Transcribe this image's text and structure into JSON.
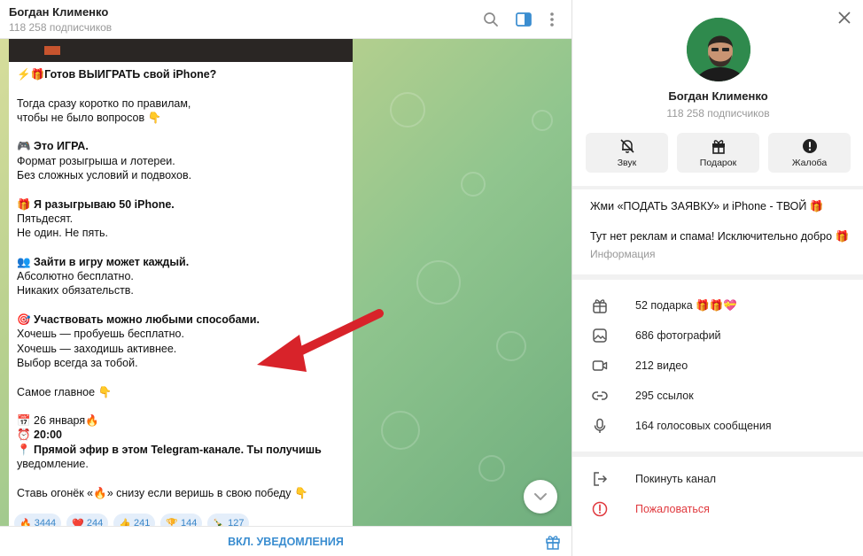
{
  "chat": {
    "title": "Богдан Клименко",
    "subscribers": "118 258 подписчиков",
    "message": {
      "lines": [
        {
          "text": "⚡🎁Готов ВЫИГРАТЬ свой iPhone?",
          "bold": true
        },
        {
          "text": ""
        },
        {
          "text": "Тогда сразу коротко по правилам,"
        },
        {
          "text": "чтобы не было вопросов 👇"
        },
        {
          "text": ""
        },
        {
          "text": "🎮 Это ИГРА.",
          "bold": true
        },
        {
          "text": "Формат розыгрыша и лотереи."
        },
        {
          "text": "Без сложных условий и подвохов."
        },
        {
          "text": ""
        },
        {
          "text": "🎁 Я разыгрываю 50 iPhone.",
          "bold": true
        },
        {
          "text": "Пятьдесят."
        },
        {
          "text": "Не один. Не пять."
        },
        {
          "text": ""
        },
        {
          "text": "👥 Зайти в игру может каждый.",
          "bold": true
        },
        {
          "text": "Абсолютно бесплатно."
        },
        {
          "text": "Никаких обязательств."
        },
        {
          "text": ""
        },
        {
          "text": "🎯 Участвовать можно любыми способами.",
          "bold": true
        },
        {
          "text": "Хочешь — пробуешь бесплатно."
        },
        {
          "text": "Хочешь — заходишь активнее."
        },
        {
          "text": "Выбор всегда за тобой."
        },
        {
          "text": ""
        },
        {
          "text": "Самое главное 👇"
        },
        {
          "text": ""
        },
        {
          "text": "📅 26 января🔥"
        },
        {
          "text": "⏰ 20:00",
          "bold": true
        },
        {
          "text": "📍 Прямой эфир в этом Telegram-канале. Ты получишь",
          "bold": true
        },
        {
          "text": "уведомление."
        },
        {
          "text": ""
        },
        {
          "text": "Ставь огонёк «🔥» снизу если веришь в свою победу 👇"
        }
      ]
    },
    "reactions": [
      {
        "emoji": "🔥",
        "count": "3444"
      },
      {
        "emoji": "❤️",
        "count": "244"
      },
      {
        "emoji": "👍",
        "count": "241"
      },
      {
        "emoji": "🏆",
        "count": "144"
      },
      {
        "emoji": "🍾",
        "count": "127"
      }
    ],
    "footer_button": "ВКЛ. УВЕДОМЛЕНИЯ"
  },
  "info": {
    "name": "Богдан Клименко",
    "subscribers": "118 258 подписчиков",
    "actions": [
      {
        "label": "Звук",
        "icon": "bell-off-icon"
      },
      {
        "label": "Подарок",
        "icon": "gift-icon"
      },
      {
        "label": "Жалоба",
        "icon": "alert-icon"
      }
    ],
    "description": {
      "line1": "Жми «ПОДАТЬ ЗАЯВКУ» и iPhone - ТВОЙ 🎁",
      "line2": "Тут нет реклам и спама! Исключительно добро 🎁",
      "label": "Информация"
    },
    "media": [
      {
        "label": "52 подарка 🎁🎁💝",
        "icon": "gift-box-icon"
      },
      {
        "label": "686 фотографий",
        "icon": "photo-icon"
      },
      {
        "label": "212 видео",
        "icon": "video-icon"
      },
      {
        "label": "295 ссылок",
        "icon": "link-icon"
      },
      {
        "label": "164 голосовых сообщения",
        "icon": "microphone-icon"
      }
    ],
    "leave": "Покинуть канал",
    "report": "Пожаловаться"
  },
  "colors": {
    "accent": "#3a8dd0",
    "danger": "#e0393e",
    "arrow": "#d8232a"
  }
}
